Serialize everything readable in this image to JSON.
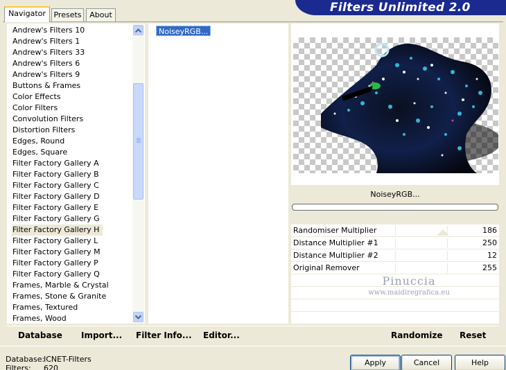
{
  "app": {
    "title": "Filters Unlimited 2.0"
  },
  "tabs": [
    {
      "label": "Navigator",
      "active": true
    },
    {
      "label": "Presets",
      "active": false
    },
    {
      "label": "About",
      "active": false
    }
  ],
  "categories": {
    "items": [
      "Andrew's Filters 10",
      "Andrew's Filters 1",
      "Andrew's Filters 33",
      "Andrew's Filters 6",
      "Andrew's Filters 9",
      "Buttons & Frames",
      "Color Effects",
      "Color Filters",
      "Convolution Filters",
      "Distortion Filters",
      "Edges, Round",
      "Edges, Square",
      "Filter Factory Gallery A",
      "Filter Factory Gallery B",
      "Filter Factory Gallery C",
      "Filter Factory Gallery D",
      "Filter Factory Gallery E",
      "Filter Factory Gallery G",
      "Filter Factory Gallery H",
      "Filter Factory Gallery L",
      "Filter Factory Gallery M",
      "Filter Factory Gallery P",
      "Filter Factory Gallery Q",
      "Frames, Marble & Crystal",
      "Frames, Stone & Granite",
      "Frames, Textured",
      "Frames, Wood"
    ],
    "selected": "Filter Factory Gallery H"
  },
  "filters": {
    "items": [
      "NoiseyRGB..."
    ],
    "selected": "NoiseyRGB..."
  },
  "preview": {
    "filter_name": "NoiseyRGB..."
  },
  "params": [
    {
      "label": "Randomiser Multiplier",
      "value": "186"
    },
    {
      "label": "Distance Multiplier #1",
      "value": "250"
    },
    {
      "label": "Distance Multiplier #2",
      "value": "12"
    },
    {
      "label": "Original Remover",
      "value": "255"
    }
  ],
  "watermark": {
    "title": "Pinuccia",
    "url": "www.maidiregrafica.eu"
  },
  "toolbar": {
    "database": "Database",
    "import": "Import...",
    "filter_info": "Filter Info...",
    "editor": "Editor...",
    "randomize": "Randomize",
    "reset": "Reset"
  },
  "status": {
    "database_label": "Database:",
    "database_value": "ICNET-Filters",
    "filters_label": "Filters:",
    "filters_value": "620"
  },
  "dialog_buttons": {
    "apply": "Apply",
    "cancel": "Cancel",
    "help": "Help"
  },
  "colors": {
    "banner": "#1a2a8f",
    "selection": "#316ac5",
    "tab_highlight": "#ffc83c"
  }
}
